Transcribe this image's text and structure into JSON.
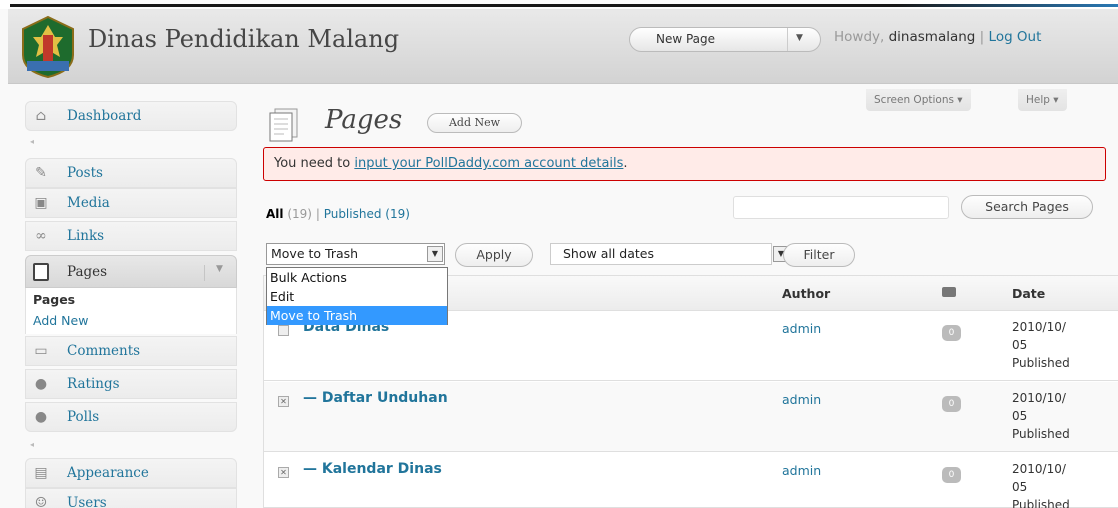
{
  "header": {
    "site_title": "Dinas Pendidikan Malang",
    "favorite_action": "New Page",
    "howdy_prefix": "Howdy,",
    "username": "dinasmalang",
    "separator": "|",
    "logout": "Log Out"
  },
  "sidebar": {
    "dashboard": "Dashboard",
    "posts": "Posts",
    "media": "Media",
    "links": "Links",
    "pages": "Pages",
    "pages_sub": [
      "Pages",
      "Add New"
    ],
    "comments": "Comments",
    "ratings": "Ratings",
    "polls": "Polls",
    "appearance": "Appearance",
    "users": "Users"
  },
  "screen_meta": {
    "screen_options": "Screen Options ▾",
    "help": "Help ▾"
  },
  "main": {
    "title": "Pages",
    "add_new": "Add New",
    "notice_prefix": "You need to ",
    "notice_link": "input your PollDaddy.com account details",
    "notice_suffix": ".",
    "filter_all": "All",
    "filter_all_count": "(19)",
    "filter_sep": "|",
    "filter_published": "Published",
    "filter_published_count": "(19)",
    "search_button": "Search Pages",
    "search_value": "",
    "bulk_action_selected": "Move to Trash",
    "bulk_options": [
      "Bulk Actions",
      "Edit",
      "Move to Trash"
    ],
    "apply": "Apply",
    "date_selected": "Show all dates",
    "filter": "Filter"
  },
  "table": {
    "columns": [
      "Author",
      "Date"
    ],
    "rows": [
      {
        "title": "Data Dinas",
        "author": "admin",
        "comments": "0",
        "date_line1": "2010/10/",
        "date_line2": "05",
        "status": "Published"
      },
      {
        "title": "— Daftar Unduhan",
        "author": "admin",
        "comments": "0",
        "date_line1": "2010/10/",
        "date_line2": "05",
        "status": "Published"
      },
      {
        "title": "— Kalendar Dinas",
        "author": "admin",
        "comments": "0",
        "date_line1": "2010/10/",
        "date_line2": "05",
        "status": "Published"
      }
    ]
  },
  "icons": {
    "comment_head": "comment-bubble-icon",
    "dropdown": "chevron-down-icon"
  }
}
